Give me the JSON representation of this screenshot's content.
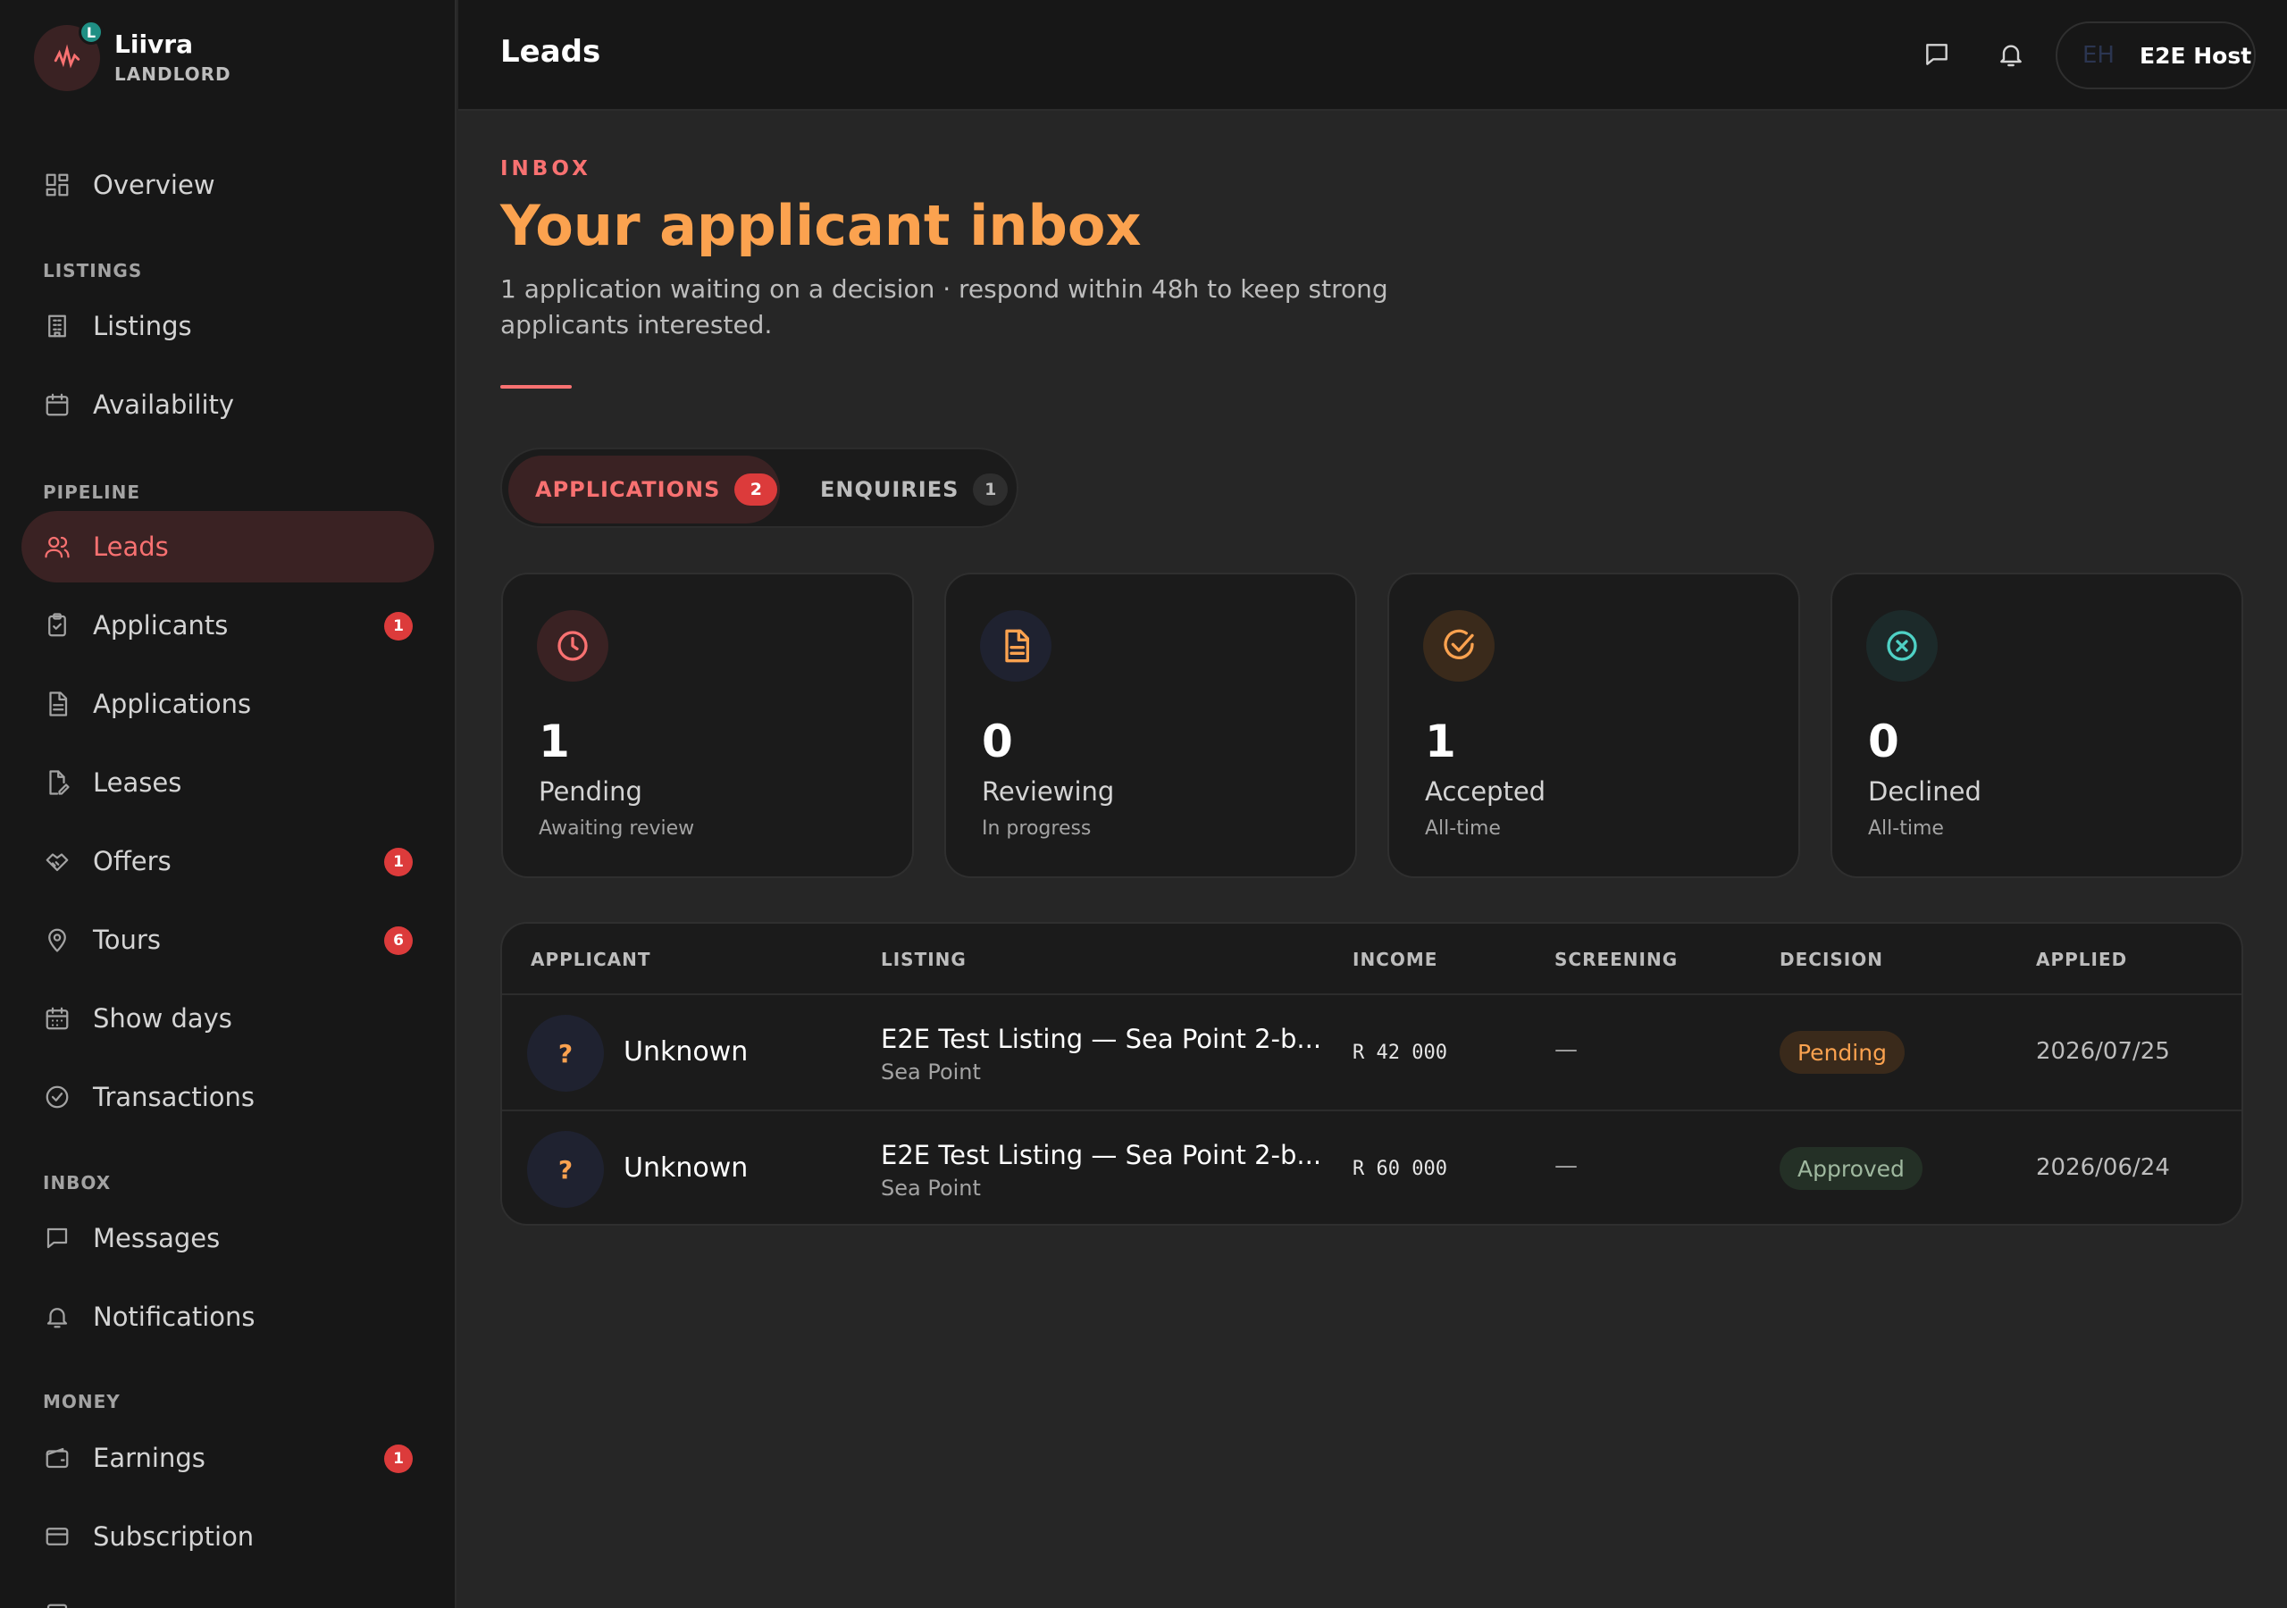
{
  "brand": {
    "name": "Liivra",
    "role": "LANDLORD",
    "badge": "L"
  },
  "sidebar": {
    "overview": "Overview",
    "sections": {
      "listings": "LISTINGS",
      "pipeline": "PIPELINE",
      "inbox": "INBOX",
      "money": "MONEY"
    },
    "items": {
      "listings": {
        "label": "Listings",
        "icon": "building-icon"
      },
      "availability": {
        "label": "Availability",
        "icon": "calendar-icon"
      },
      "leads": {
        "label": "Leads",
        "icon": "users-icon",
        "active": true
      },
      "applicants": {
        "label": "Applicants",
        "icon": "clipboard-icon",
        "badge": "1"
      },
      "applications": {
        "label": "Applications",
        "icon": "file-icon"
      },
      "leases": {
        "label": "Leases",
        "icon": "file-signature-icon"
      },
      "offers": {
        "label": "Offers",
        "icon": "handshake-icon",
        "badge": "1"
      },
      "tours": {
        "label": "Tours",
        "icon": "map-pin-icon",
        "badge": "6"
      },
      "show_days": {
        "label": "Show days",
        "icon": "calendar-days-icon"
      },
      "transactions": {
        "label": "Transactions",
        "icon": "badge-check-icon"
      },
      "messages": {
        "label": "Messages",
        "icon": "message-icon"
      },
      "notifications": {
        "label": "Notifications",
        "icon": "bell-icon"
      },
      "earnings": {
        "label": "Earnings",
        "icon": "wallet-icon",
        "badge": "1"
      },
      "subscription": {
        "label": "Subscription",
        "icon": "credit-card-icon"
      }
    }
  },
  "header": {
    "title": "Leads",
    "user_initials": "EH",
    "user_name": "E2E Host"
  },
  "main": {
    "eyebrow": "INBOX",
    "title": "Your applicant inbox",
    "subtitle": "1 application waiting on a decision · respond within 48h to keep strong applicants interested.",
    "tabs": [
      {
        "label": "APPLICATIONS",
        "count": "2",
        "active": true
      },
      {
        "label": "ENQUIRIES",
        "count": "1",
        "active": false
      }
    ],
    "stats": [
      {
        "value": "1",
        "label": "Pending",
        "sub": "Awaiting review",
        "icon": "clock-icon",
        "color": "#f87171"
      },
      {
        "value": "0",
        "label": "Reviewing",
        "sub": "In progress",
        "icon": "document-icon",
        "color": "#fba24f"
      },
      {
        "value": "1",
        "label": "Accepted",
        "sub": "All-time",
        "icon": "check-circle-icon",
        "color": "#fba24f"
      },
      {
        "value": "0",
        "label": "Declined",
        "sub": "All-time",
        "icon": "x-circle-icon",
        "color": "#4fd1c5"
      }
    ],
    "table": {
      "headers": [
        "APPLICANT",
        "LISTING",
        "INCOME",
        "SCREENING",
        "DECISION",
        "APPLIED"
      ],
      "rows": [
        {
          "avatar": "?",
          "applicant": "Unknown",
          "listing": "E2E Test Listing — Sea Point 2-b...",
          "area": "Sea Point",
          "income": "R 42 000",
          "screening": "—",
          "decision": "Pending",
          "applied": "2026/07/25"
        },
        {
          "avatar": "?",
          "applicant": "Unknown",
          "listing": "E2E Test Listing — Sea Point 2-b...",
          "area": "Sea Point",
          "income": "R 60 000",
          "screening": "—",
          "decision": "Approved",
          "applied": "2026/06/24"
        }
      ]
    }
  },
  "colors": {
    "accent": "#f87171",
    "brand_orange": "#fba24f",
    "badge_red": "#dc3b3b",
    "teal": "#4fd1c5"
  }
}
